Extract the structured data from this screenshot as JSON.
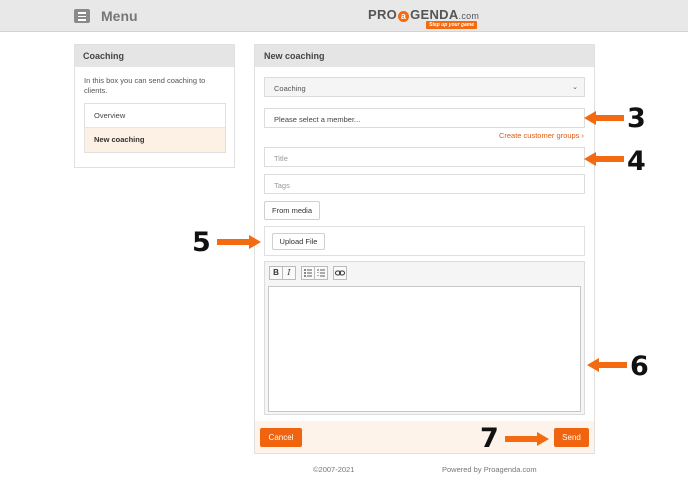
{
  "header": {
    "menu_label": "Menu",
    "logo_text_pre": "PRO",
    "logo_text_post": "GENDA",
    "logo_ring": "a",
    "logo_dotcom": ".com",
    "logo_tagline": "Step up your game"
  },
  "sidebar": {
    "title": "Coaching",
    "description": "In this box you can send coaching to clients.",
    "items": [
      {
        "label": "Overview"
      },
      {
        "label": "New coaching"
      }
    ]
  },
  "form": {
    "title": "New coaching",
    "type_select": "Coaching",
    "member_select": "Please select a member...",
    "customer_groups_link": "Create customer groups ›",
    "title_placeholder": "Title",
    "tags_placeholder": "Tags",
    "from_media_label": "From media",
    "upload_label": "Upload File",
    "toolbar": [
      "B",
      "I",
      "bulleted-list",
      "numbered-list",
      "link"
    ],
    "cancel_label": "Cancel",
    "send_label": "Send"
  },
  "annotations": [
    "3",
    "4",
    "5",
    "6",
    "7"
  ],
  "annotation_color": "#f36a10",
  "footer": {
    "copyright": "©2007-2021",
    "powered": "Powered by Proagenda.com"
  }
}
